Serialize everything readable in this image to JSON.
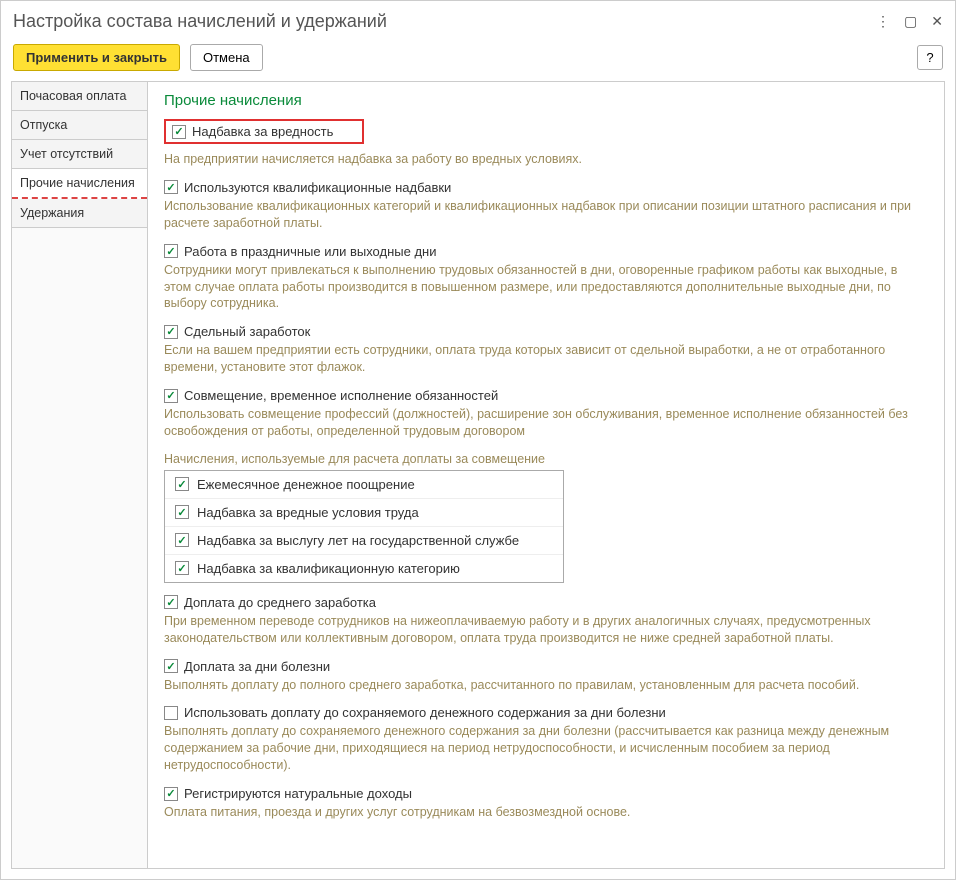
{
  "title": "Настройка состава начислений и удержаний",
  "toolbar": {
    "apply": "Применить и закрыть",
    "cancel": "Отмена",
    "help": "?"
  },
  "tabs": [
    "Почасовая оплата",
    "Отпуска",
    "Учет отсутствий",
    "Прочие начисления",
    "Удержания"
  ],
  "activeTab": 3,
  "section": {
    "title": "Прочие начисления"
  },
  "opts": [
    {
      "label": "Надбавка за вредность",
      "checked": true,
      "highlight": true,
      "desc": "На предприятии начисляется надбавка за работу во вредных условиях."
    },
    {
      "label": "Используются квалификационные надбавки",
      "checked": true,
      "desc": "Использование квалификационных категорий и квалификационных надбавок при описании позиции штатного расписания и при расчете заработной платы."
    },
    {
      "label": "Работа в праздничные или выходные дни",
      "checked": true,
      "desc": "Сотрудники могут привлекаться к выполнению трудовых обязанностей в дни, оговоренные графиком работы как выходные, в этом случае оплата работы производится в повышенном размере, или предоставляются дополнительные выходные дни, по выбору сотрудника."
    },
    {
      "label": "Сдельный заработок",
      "checked": true,
      "desc": "Если на вашем предприятии есть сотрудники, оплата труда которых зависит от сдельной выработки, а не от отработанного времени, установите этот флажок."
    },
    {
      "label": "Совмещение, временное исполнение обязанностей",
      "checked": true,
      "desc": "Использовать совмещение профессий (должностей), расширение зон обслуживания, временное исполнение обязанностей без освобождения от работы, определенной трудовым договором"
    }
  ],
  "listLabel": "Начисления, используемые для расчета доплаты за совмещение",
  "listItems": [
    {
      "label": "Ежемесячное денежное поощрение",
      "checked": true
    },
    {
      "label": "Надбавка за вредные условия труда",
      "checked": true
    },
    {
      "label": "Надбавка за выслугу лет на государственной службе",
      "checked": true
    },
    {
      "label": "Надбавка за квалификационную категорию",
      "checked": true
    }
  ],
  "opts2": [
    {
      "label": "Доплата до среднего заработка",
      "checked": true,
      "desc": "При временном переводе сотрудников на нижеоплачиваемую работу и в других аналогичных случаях, предусмотренных законодательством или коллективным договором, оплата труда производится не ниже средней заработной платы."
    },
    {
      "label": "Доплата за дни болезни",
      "checked": true,
      "desc": "Выполнять доплату до полного среднего заработка, рассчитанного по правилам, установленным для расчета пособий."
    },
    {
      "label": "Использовать доплату до сохраняемого денежного содержания за дни болезни",
      "checked": false,
      "desc": "Выполнять доплату до сохраняемого денежного содержания за дни болезни (рассчитывается как разница между денежным содержанием за рабочие дни, приходящиеся на период нетрудоспособности, и исчисленным пособием за период нетрудоспособности)."
    },
    {
      "label": "Регистрируются натуральные доходы",
      "checked": true,
      "desc": "Оплата питания, проезда и других услуг сотрудникам на безвозмездной основе."
    }
  ]
}
